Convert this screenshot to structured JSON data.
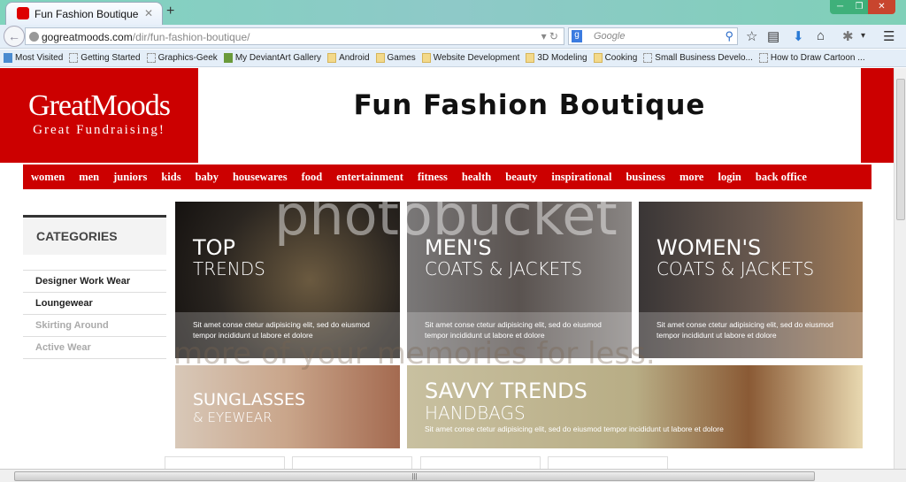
{
  "browser": {
    "tab_title": "Fun Fashion Boutique",
    "new_tab": "+",
    "url_domain": "gogreatmoods.com",
    "url_path": "/dir/fun-fashion-boutique/",
    "search_placeholder": "Google",
    "search_engine": "g"
  },
  "bookmarks": [
    {
      "label": "Most Visited",
      "icon": "most-visited"
    },
    {
      "label": "Getting Started",
      "icon": "page"
    },
    {
      "label": "Graphics-Geek",
      "icon": "page"
    },
    {
      "label": "My DeviantArt Gallery",
      "icon": "deviantart"
    },
    {
      "label": "Android",
      "icon": "folder"
    },
    {
      "label": "Games",
      "icon": "folder"
    },
    {
      "label": "Website Development",
      "icon": "folder"
    },
    {
      "label": "3D Modeling",
      "icon": "folder"
    },
    {
      "label": "Cooking",
      "icon": "folder"
    },
    {
      "label": "Small Business Develo...",
      "icon": "page"
    },
    {
      "label": "How to Draw Cartoon ...",
      "icon": "page"
    }
  ],
  "site": {
    "logo_line1": "GreatMoods",
    "logo_line2": "Great Fundraising!",
    "title": "Fun Fashion Boutique",
    "menu": [
      "women",
      "men",
      "juniors",
      "kids",
      "baby",
      "housewares",
      "food",
      "entertainment",
      "fitness",
      "health",
      "beauty",
      "inspirational",
      "business",
      "more",
      "login",
      "back office"
    ],
    "categories_heading": "CATEGORIES",
    "categories": [
      {
        "label": "Designer Work Wear",
        "dim": false
      },
      {
        "label": "Loungewear",
        "dim": false
      },
      {
        "label": "Skirting Around",
        "dim": true
      },
      {
        "label": "Active Wear",
        "dim": true
      }
    ],
    "tiles": [
      {
        "line1": "TOP",
        "line2": "TRENDS",
        "caption": "Sit amet conse ctetur adipisicing elit, sed do eiusmod tempor incididunt ut labore et dolore"
      },
      {
        "line1": "MEN'S",
        "line2": "COATS & JACKETS",
        "caption": "Sit amet conse ctetur adipisicing elit, sed do eiusmod tempor incididunt ut labore et dolore"
      },
      {
        "line1": "WOMEN'S",
        "line2": "COATS & JACKETS",
        "caption": "Sit amet conse ctetur adipisicing elit, sed do eiusmod tempor incididunt ut labore et dolore"
      },
      {
        "line1": "SUNGLASSES",
        "line2": "& EYEWEAR"
      },
      {
        "line1": "SAVVY TRENDS",
        "line2": "HANDBAGS",
        "caption": "Sit amet conse ctetur adipisicing elit, sed do eiusmod tempor incididunt ut labore et dolore"
      }
    ]
  },
  "watermark": {
    "brand": "photobucket",
    "slogan": "more of your memories for less."
  }
}
